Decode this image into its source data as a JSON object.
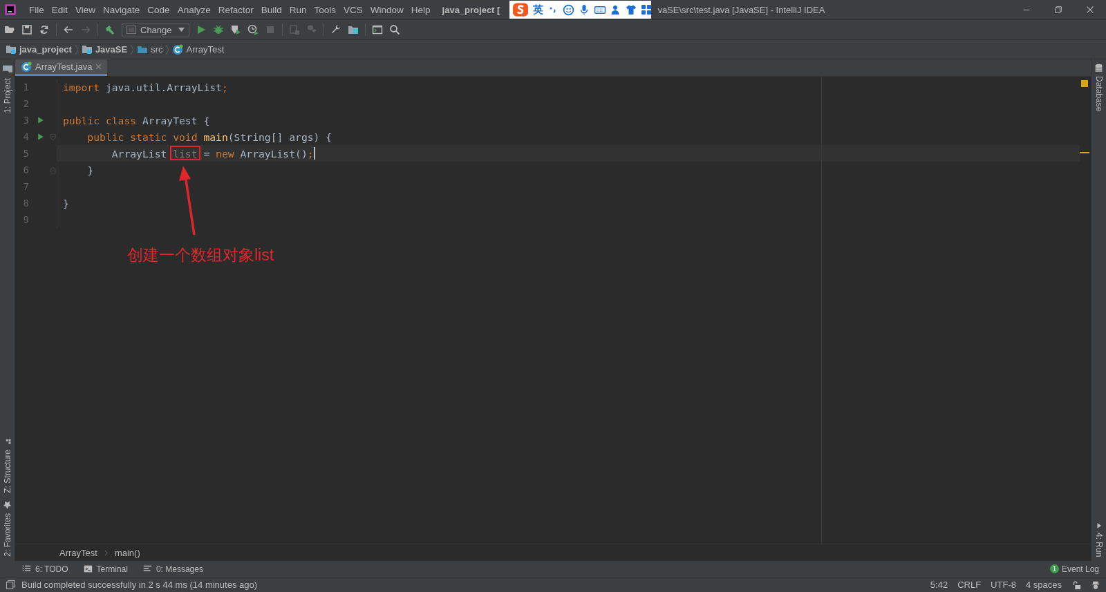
{
  "window": {
    "title_left": "java_project [",
    "title_right": "vaSE\\src\\test.java [JavaSE] - IntelliJ IDEA"
  },
  "menu": [
    "File",
    "Edit",
    "View",
    "Navigate",
    "Code",
    "Analyze",
    "Refactor",
    "Build",
    "Run",
    "Tools",
    "VCS",
    "Window",
    "Help"
  ],
  "ime_bar": {
    "label": "英"
  },
  "toolbar": {
    "run_config": "Change"
  },
  "breadcrumbs": [
    {
      "label": "java_project",
      "kind": "module"
    },
    {
      "label": "JavaSE",
      "kind": "module"
    },
    {
      "label": "src",
      "kind": "folder"
    },
    {
      "label": "ArrayTest",
      "kind": "class"
    }
  ],
  "left_tools_top": [
    {
      "label": "1: Project",
      "kind": "project"
    }
  ],
  "left_tools_bottom": [
    {
      "label": "Z: Structure",
      "kind": "structure"
    },
    {
      "label": "2: Favorites",
      "kind": "favorites"
    }
  ],
  "right_tools_top": [
    {
      "label": "Database",
      "kind": "database"
    }
  ],
  "right_tools_bottom": [
    {
      "label": "4: Run",
      "kind": "run"
    }
  ],
  "editor_tabs": [
    {
      "label": "ArrayTest.java",
      "selected": true
    }
  ],
  "code_lines": [
    {
      "number": "1",
      "runnable": false,
      "fold_start": false,
      "fold_end": false,
      "current": false,
      "warning": false,
      "tokens": [
        {
          "text": "import",
          "kind": "keyword"
        },
        {
          "text": " java.util.ArrayList",
          "kind": "plain"
        },
        {
          "text": ";",
          "kind": "keyword"
        }
      ]
    },
    {
      "number": "2",
      "runnable": false,
      "fold_start": false,
      "fold_end": false,
      "current": false,
      "warning": false
    },
    {
      "number": "3",
      "runnable": true,
      "fold_start": false,
      "fold_end": false,
      "current": false,
      "warning": false,
      "tokens": [
        {
          "text": "public class",
          "kind": "keyword"
        },
        {
          "text": " ArrayTest {",
          "kind": "plain"
        }
      ]
    },
    {
      "number": "4",
      "runnable": true,
      "fold_start": true,
      "fold_end": false,
      "current": false,
      "warning": false,
      "tokens": [
        {
          "text": "    public static void ",
          "kind": "keyword"
        },
        {
          "text": "main",
          "kind": "method"
        },
        {
          "text": "(String[] args) {",
          "kind": "plain"
        }
      ]
    },
    {
      "number": "5",
      "runnable": false,
      "fold_start": false,
      "fold_end": false,
      "current": true,
      "warning": true,
      "tokens": [
        {
          "text": "        ArrayList ",
          "kind": "plain"
        },
        {
          "text": "list",
          "kind": "unused",
          "annotated": true
        },
        {
          "text": " = ",
          "kind": "plain"
        },
        {
          "text": "new",
          "kind": "keyword"
        },
        {
          "text": " ArrayList()",
          "kind": "plain"
        },
        {
          "text": ";",
          "kind": "keyword"
        }
      ]
    },
    {
      "number": "6",
      "runnable": false,
      "fold_start": false,
      "fold_end": true,
      "current": false,
      "warning": false,
      "tokens": [
        {
          "text": "    }",
          "kind": "plain"
        }
      ]
    },
    {
      "number": "7",
      "runnable": false,
      "fold_start": false,
      "fold_end": false,
      "current": false,
      "warning": false
    },
    {
      "number": "8",
      "runnable": false,
      "fold_start": false,
      "fold_end": false,
      "current": false,
      "warning": false,
      "tokens": [
        {
          "text": "}",
          "kind": "plain"
        }
      ]
    },
    {
      "number": "9",
      "runnable": false,
      "fold_start": false,
      "fold_end": false,
      "current": false,
      "warning": false
    }
  ],
  "annotation": {
    "label": "创建一个数组对象list"
  },
  "code_breadcrumbs": [
    "ArrayTest",
    "main()"
  ],
  "tool_windows": [
    {
      "label": "6: TODO",
      "kind": "todo"
    },
    {
      "label": "Terminal",
      "kind": "terminal"
    },
    {
      "label": "0: Messages",
      "kind": "messages"
    }
  ],
  "event_log": {
    "count": "1",
    "label": "Event Log"
  },
  "status": {
    "message": "Build completed successfully in 2 s 44 ms (14 minutes ago)",
    "position": "5:42",
    "line_separator": "CRLF",
    "encoding": "UTF-8",
    "indent": "4 spaces"
  }
}
